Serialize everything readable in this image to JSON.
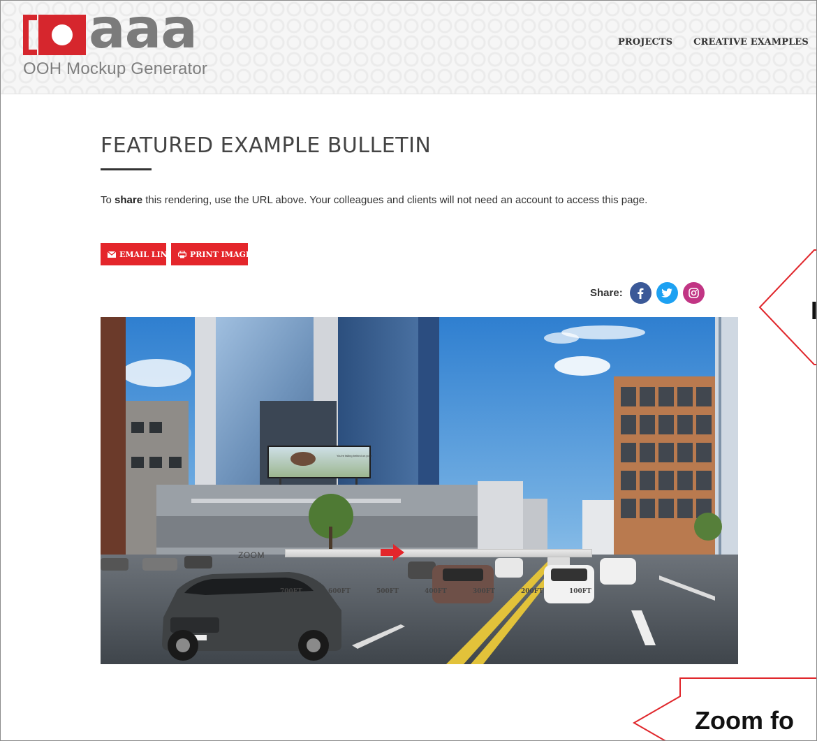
{
  "header": {
    "logo_word": "aaa",
    "logo_tagline": "OOH Mockup Generator",
    "nav": [
      "PROJECTS",
      "CREATIVE EXAMPLES"
    ]
  },
  "content": {
    "title": "FEATURED EXAMPLE BULLETIN",
    "desc_prefix": "To ",
    "desc_bold": "share",
    "desc_rest": " this rendering, use the URL above. Your colleagues and clients will not need an account to access this page.",
    "email_button": "EMAIL LINK",
    "print_button": "PRINT IMAGE",
    "share_label": "Share:",
    "billboard_text": "You're falling behind on your"
  },
  "zoom": {
    "label": "ZOOM",
    "ticks": [
      "700FT",
      "600FT",
      "500FT",
      "400FT",
      "300FT",
      "200FT",
      "100FT"
    ],
    "level_fraction": 0.35
  },
  "callouts": {
    "upper_partial_text": "I",
    "lower_text": "Zoom fo"
  },
  "colors": {
    "accent_red": "#e4262b",
    "facebook": "#3b5998",
    "twitter": "#1da1f2",
    "instagram": "#c13584"
  }
}
